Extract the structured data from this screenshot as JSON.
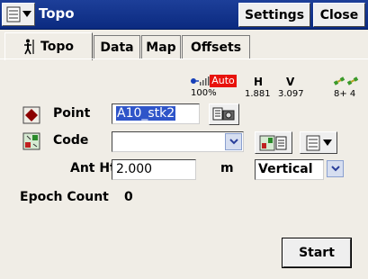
{
  "window": {
    "title": "Topo",
    "settings_label": "Settings",
    "close_label": "Close"
  },
  "tabs": [
    {
      "label": "Topo",
      "active": true
    },
    {
      "label": "Data",
      "active": false
    },
    {
      "label": "Map",
      "active": false
    },
    {
      "label": "Offsets",
      "active": false
    }
  ],
  "status": {
    "auto": "Auto",
    "battery_percent": "100%",
    "h_label": "H",
    "h_value": "1.881",
    "v_label": "V",
    "v_value": "3.097",
    "satellites": "8+ 4"
  },
  "form": {
    "point_label": "Point",
    "point_value": "A10_stk2",
    "code_label": "Code",
    "code_value": "",
    "ant_ht_label": "Ant Ht",
    "ant_ht_value": "2.000",
    "ant_ht_unit": "m",
    "ant_ht_type": "Vertical",
    "epoch_count_label": "Epoch Count",
    "epoch_count_value": "0"
  },
  "actions": {
    "start_label": "Start"
  },
  "colors": {
    "titlebar": "#0b2a80",
    "auto_badge": "#e8130c",
    "point_marker": "#8b0000",
    "selection": "#2f55c9"
  },
  "icons": [
    "menu-icon",
    "surveyor-icon",
    "signal-icon",
    "satellite-icon",
    "point-marker-icon",
    "code-library-icon",
    "camera-note-icon",
    "code-list-icon",
    "dropdown-icon"
  ]
}
